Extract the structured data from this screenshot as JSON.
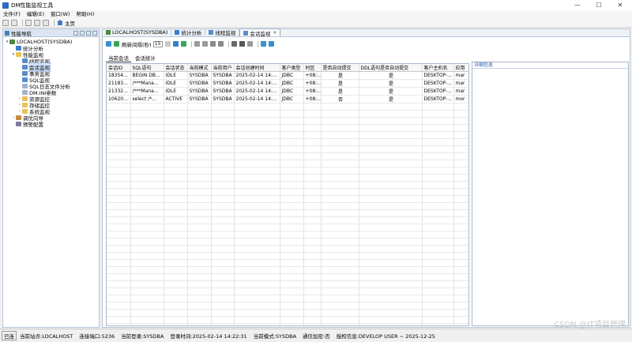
{
  "window": {
    "title": "DM性能监视工具",
    "minimize": "—",
    "maximize": "☐",
    "close": "✕"
  },
  "menu": [
    "文件(F)",
    "编辑(E)",
    "窗口(W)",
    "帮助(H)"
  ],
  "toolbar": {
    "home_label": "主页"
  },
  "nav_panel": {
    "title": "性能导航",
    "tree": [
      {
        "label": "LOCALHOST(SYSDBA)",
        "depth": 0,
        "twisty": "▾",
        "icon": "db-icon"
      },
      {
        "label": "统计分析",
        "depth": 1,
        "twisty": "",
        "icon": "chart-icon"
      },
      {
        "label": "性能监视",
        "depth": 1,
        "twisty": "▾",
        "icon": "folder-icon"
      },
      {
        "label": "线程监视",
        "depth": 2,
        "twisty": "",
        "icon": "monitor-icon"
      },
      {
        "label": "会话监视",
        "depth": 2,
        "twisty": "",
        "icon": "monitor-icon",
        "selected": true
      },
      {
        "label": "事务监视",
        "depth": 2,
        "twisty": "",
        "icon": "monitor-icon"
      },
      {
        "label": "SQL监视",
        "depth": 2,
        "twisty": "",
        "icon": "monitor-icon"
      },
      {
        "label": "SQL日志文件分析",
        "depth": 2,
        "twisty": "",
        "icon": "doc-icon"
      },
      {
        "label": "DM.INI参数",
        "depth": 2,
        "twisty": "",
        "icon": "doc-icon"
      },
      {
        "label": "资源监控",
        "depth": 2,
        "twisty": "›",
        "icon": "folder-icon"
      },
      {
        "label": "存储监控",
        "depth": 2,
        "twisty": "›",
        "icon": "folder-icon"
      },
      {
        "label": "系统监视",
        "depth": 2,
        "twisty": "›",
        "icon": "folder-icon"
      },
      {
        "label": "调优向导",
        "depth": 1,
        "twisty": "›",
        "icon": "wrench-icon"
      },
      {
        "label": "预警配置",
        "depth": 1,
        "twisty": "",
        "icon": "gear-icon"
      }
    ]
  },
  "tabs": [
    {
      "label": "LOCALHOST(SYSDBA)",
      "active": false
    },
    {
      "label": "统计分析",
      "active": false
    },
    {
      "label": "线程监视",
      "active": false
    },
    {
      "label": "会话监视",
      "active": true,
      "close": "✕"
    }
  ],
  "inner_toolbar": {
    "refresh_label": "刷新间隔(秒)",
    "refresh_value": "15"
  },
  "subtabs": [
    {
      "label": "当前会话",
      "active": true
    },
    {
      "label": "会话统计",
      "active": false
    }
  ],
  "session_table": {
    "columns": [
      "会话ID",
      "SQL语句",
      "会话状态",
      "当前模式",
      "当前用户",
      "会话创建时间",
      "客户类型",
      "时区",
      "是否自动提交",
      "DDL语句是否自动提交",
      "客户主机名",
      "应用"
    ],
    "rows": [
      [
        "18354...",
        "BEGIN DB...",
        "IDLE",
        "SYSDBA",
        "SYSDBA",
        "2025-02-14 14:...",
        "JDBC",
        "+08:...",
        "是",
        "是",
        "DESKTOP-...",
        "mar"
      ],
      [
        "21183...",
        "/***Mana...",
        "IDLE",
        "SYSDBA",
        "SYSDBA",
        "2025-02-14 14:...",
        "JDBC",
        "+08:...",
        "是",
        "是",
        "DESKTOP-...",
        "mar"
      ],
      [
        "21332...",
        "/***Mana...",
        "IDLE",
        "SYSDBA",
        "SYSDBA",
        "2025-02-14 14:...",
        "JDBC",
        "+08:...",
        "是",
        "是",
        "DESKTOP-...",
        "mar"
      ],
      [
        "10620...",
        "select /*...",
        "ACTIVE",
        "SYSDBA",
        "SYSDBA",
        "2025-02-14 14:...",
        "JDBC",
        "+08:...",
        "否",
        "是",
        "DESKTOP-...",
        "mor"
      ]
    ]
  },
  "detail_panel": {
    "title": "详细信息"
  },
  "status": {
    "prefix": "已连",
    "site": "当前站点:LOCALHOST",
    "port": "连接端口:5236",
    "login": "当前登录:SYSDBA",
    "login_time": "登录时间:2025-02-14 14:22:31",
    "mode": "当前模式:SYSDBA",
    "encrypt": "通信加密:否",
    "license": "授权信息:DEVELOP USER ~ 2025-12-25"
  },
  "watermark": "CSDN @IT项目管理"
}
